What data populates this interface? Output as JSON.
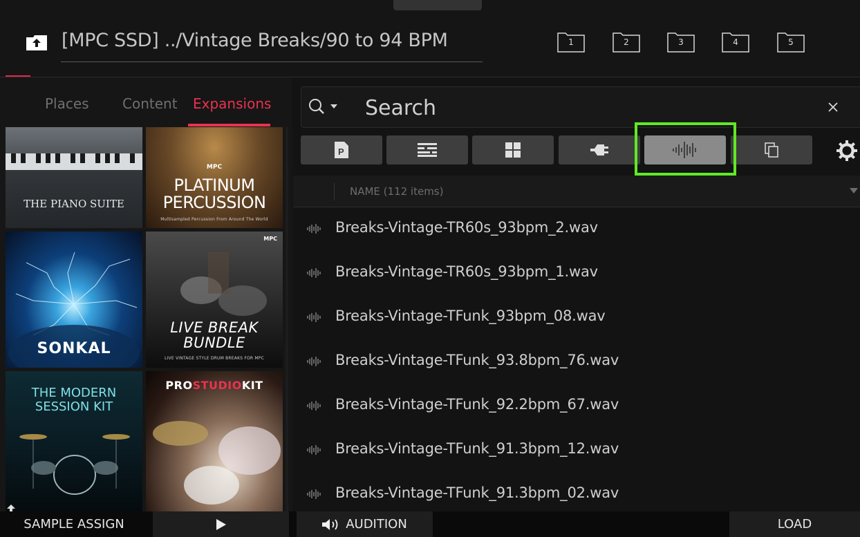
{
  "header": {
    "path": "[MPC SSD] ../Vintage Breaks/90 to 94 BPM",
    "slots": [
      "1",
      "2",
      "3",
      "4",
      "5"
    ]
  },
  "tabs": [
    {
      "label": "Places",
      "active": false
    },
    {
      "label": "Content",
      "active": false
    },
    {
      "label": "Expansions",
      "active": true
    }
  ],
  "expansions": [
    {
      "title": "THE PIANO SUITE",
      "subtitle": ""
    },
    {
      "title": "PLATINUM PERCUSSION",
      "logo": "MPC",
      "subtitle": "Multisampled Percussion From Around The World"
    },
    {
      "title": "SONKAL",
      "subtitle": ""
    },
    {
      "title": "LIVE BREAK BUNDLE",
      "logo": "MPC",
      "subtitle": "LIVE VINTAGE STYLE DRUM BREAKS FOR MPC"
    },
    {
      "title": "THE MODERN SESSION KIT",
      "subtitle": ""
    },
    {
      "title": "PROSTUDIOKIT",
      "title_a": "PRO",
      "title_b": "STUDIO",
      "title_c": "KIT",
      "subtitle": ""
    }
  ],
  "search": {
    "placeholder": "Search",
    "value": ""
  },
  "filters": [
    {
      "icon": "program-icon",
      "selected": false
    },
    {
      "icon": "sequence-icon",
      "selected": false
    },
    {
      "icon": "pad-grid-icon",
      "selected": false
    },
    {
      "icon": "plugin-icon",
      "selected": false
    },
    {
      "icon": "sample-waveform-icon",
      "selected": true
    },
    {
      "icon": "copy-icon",
      "selected": false
    }
  ],
  "list": {
    "header": "NAME (112 items)",
    "items": [
      "Breaks-Vintage-TR60s_93bpm_2.wav",
      "Breaks-Vintage-TR60s_93bpm_1.wav",
      "Breaks-Vintage-TFunk_93bpm_08.wav",
      "Breaks-Vintage-TFunk_93.8bpm_76.wav",
      "Breaks-Vintage-TFunk_92.2bpm_67.wav",
      "Breaks-Vintage-TFunk_91.3bpm_12.wav",
      "Breaks-Vintage-TFunk_91.3bpm_02.wav"
    ]
  },
  "bottom": {
    "sample_assign": "SAMPLE ASSIGN",
    "audition": "AUDITION",
    "load": "LOAD"
  },
  "colors": {
    "accent": "#e8334f",
    "highlight": "#5fea24",
    "selected_filter": "#8a8a8a"
  }
}
